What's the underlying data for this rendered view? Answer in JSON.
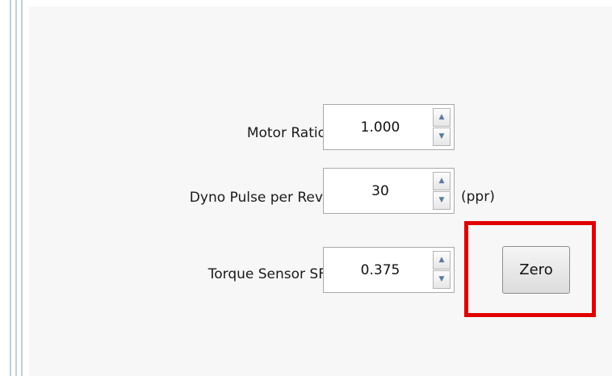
{
  "form": {
    "motor_ratio": {
      "label": "Motor Ratio",
      "value": "1.000"
    },
    "dyno_pulse": {
      "label": "Dyno Pulse per Rev.",
      "value": "30",
      "unit": "(ppr)"
    },
    "torque_sensor": {
      "label": "Torque Sensor SF",
      "value": "0.375"
    },
    "zero_button_label": "Zero"
  },
  "icons": {
    "spin_up": "▲",
    "spin_down": "▼"
  },
  "colors": {
    "highlight": "#e00000",
    "panel_background": "#f7f7f7",
    "left_lines": "#c0d0dc"
  }
}
